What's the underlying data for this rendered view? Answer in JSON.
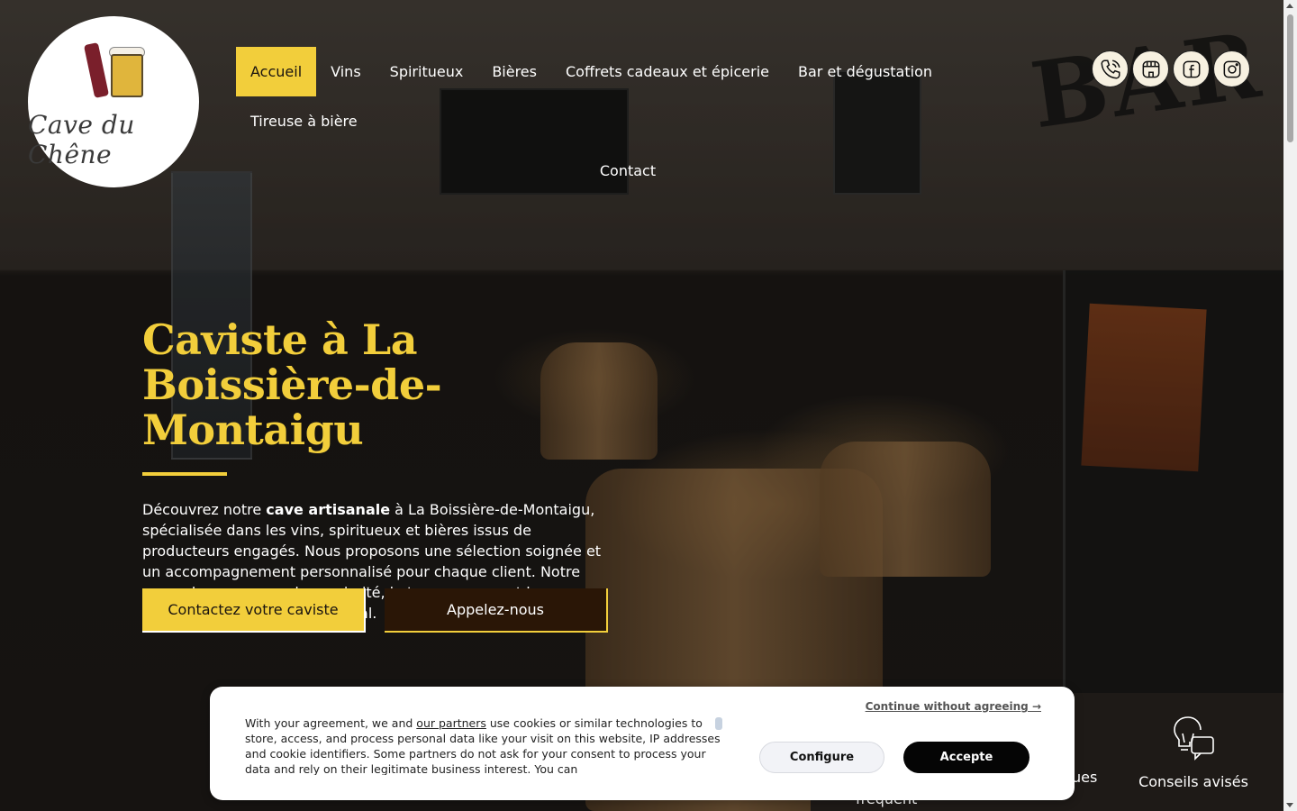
{
  "brand": {
    "name": "Cave du Chêne"
  },
  "nav": {
    "items": [
      {
        "label": "Accueil",
        "active": true
      },
      {
        "label": "Vins"
      },
      {
        "label": "Spiritueux"
      },
      {
        "label": "Bières"
      },
      {
        "label": "Coffrets cadeaux et épicerie"
      },
      {
        "label": "Bar et dégustation"
      },
      {
        "label": "Tireuse à bière"
      },
      {
        "label": "Contact"
      }
    ]
  },
  "socials": [
    {
      "icon": "phone-icon"
    },
    {
      "icon": "storefront-icon"
    },
    {
      "icon": "facebook-icon"
    },
    {
      "icon": "instagram-icon"
    }
  ],
  "hero": {
    "title": "Caviste à La Boissière-de-Montaigu",
    "desc_before": "Découvrez notre ",
    "desc_bold": "cave artisanale",
    "desc_after": " à La Boissière-de-Montaigu, spécialisée dans les vins, spiritueux et bières issus de producteurs engagés. Nous proposons une sélection soignée et un accompagnement personnalisé pour chaque client. Notre approche repose sur la proximité, la transparence et la valorisation du savoir-faire local.",
    "cta_primary": "Contactez votre caviste",
    "cta_secondary": "Appelez-nous",
    "bar_sign": "BAR"
  },
  "features": {
    "partial_1": "ues",
    "partial_2": "fréquent",
    "item_label": "Conseils avisés",
    "item_icon": "advice-icon"
  },
  "cookie": {
    "continue": "Continue without agreeing →",
    "text_before": "With your agreement, we and ",
    "partners_link": "our partners",
    "text_after": " use cookies or similar technologies to store, access, and process personal data like your visit on this website, IP addresses and cookie identifiers. Some partners do not ask for your consent to process your data and rely on their legitimate business interest. You can",
    "configure": "Configure",
    "accept": "Accepte"
  },
  "colors": {
    "accent": "#f2ce3b",
    "dark_button": "#2a1606"
  }
}
